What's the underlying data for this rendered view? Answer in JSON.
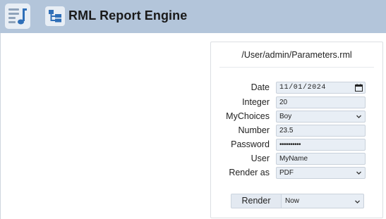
{
  "app": {
    "title": "RML Report Engine",
    "menu_icon": "music-list-icon",
    "tree_icon": "hierarchy-icon",
    "accent": "#b3c5da",
    "icon_color": "#2f6fb8"
  },
  "form": {
    "file_path": "/User/admin/Parameters.rml",
    "fields": [
      {
        "label": "Date",
        "value": "11/01/2024",
        "type": "date"
      },
      {
        "label": "Integer",
        "value": "20",
        "type": "text"
      },
      {
        "label": "MyChoices",
        "value": "Boy",
        "type": "select"
      },
      {
        "label": "Number",
        "value": "23.5",
        "type": "text"
      },
      {
        "label": "Password",
        "value": "••••••••••",
        "type": "password"
      },
      {
        "label": "User",
        "value": "MyName",
        "type": "text"
      },
      {
        "label": "Render as",
        "value": "PDF",
        "type": "select"
      }
    ],
    "render_button": "Render",
    "render_when": "Now"
  }
}
